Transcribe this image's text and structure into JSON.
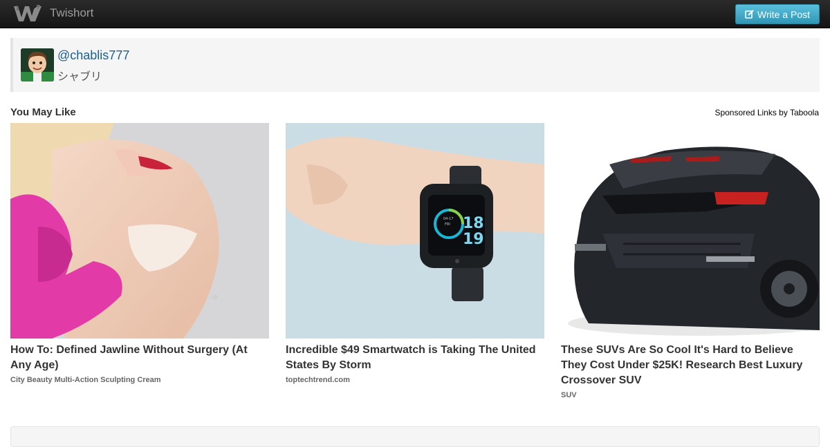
{
  "navbar": {
    "brand_name": "Twishort",
    "logo_icon": "twishort-logo-icon",
    "write_button_label": "Write a Post",
    "write_button_icon": "edit-icon"
  },
  "profile": {
    "handle": "@chablis777",
    "display_name": "シャブリ"
  },
  "recommendations": {
    "title": "You May Like",
    "sponsored_label": "Sponsored Links by Taboola",
    "cards": [
      {
        "title": "How To: Defined Jawline Without Surgery (At Any Age)",
        "source": "City Beauty Multi-Action Sculpting Cream"
      },
      {
        "title": "Incredible $49 Smartwatch is Taking The United States By Storm",
        "source": "toptechtrend.com",
        "watch_date": "04-17",
        "watch_day": "FRI",
        "watch_hour": "18",
        "watch_minute": "19"
      },
      {
        "title": "These SUVs Are So Cool It's Hard to Believe They Cost Under $25K! Research Best Luxury Crossover SUV",
        "source": "SUV"
      }
    ]
  }
}
